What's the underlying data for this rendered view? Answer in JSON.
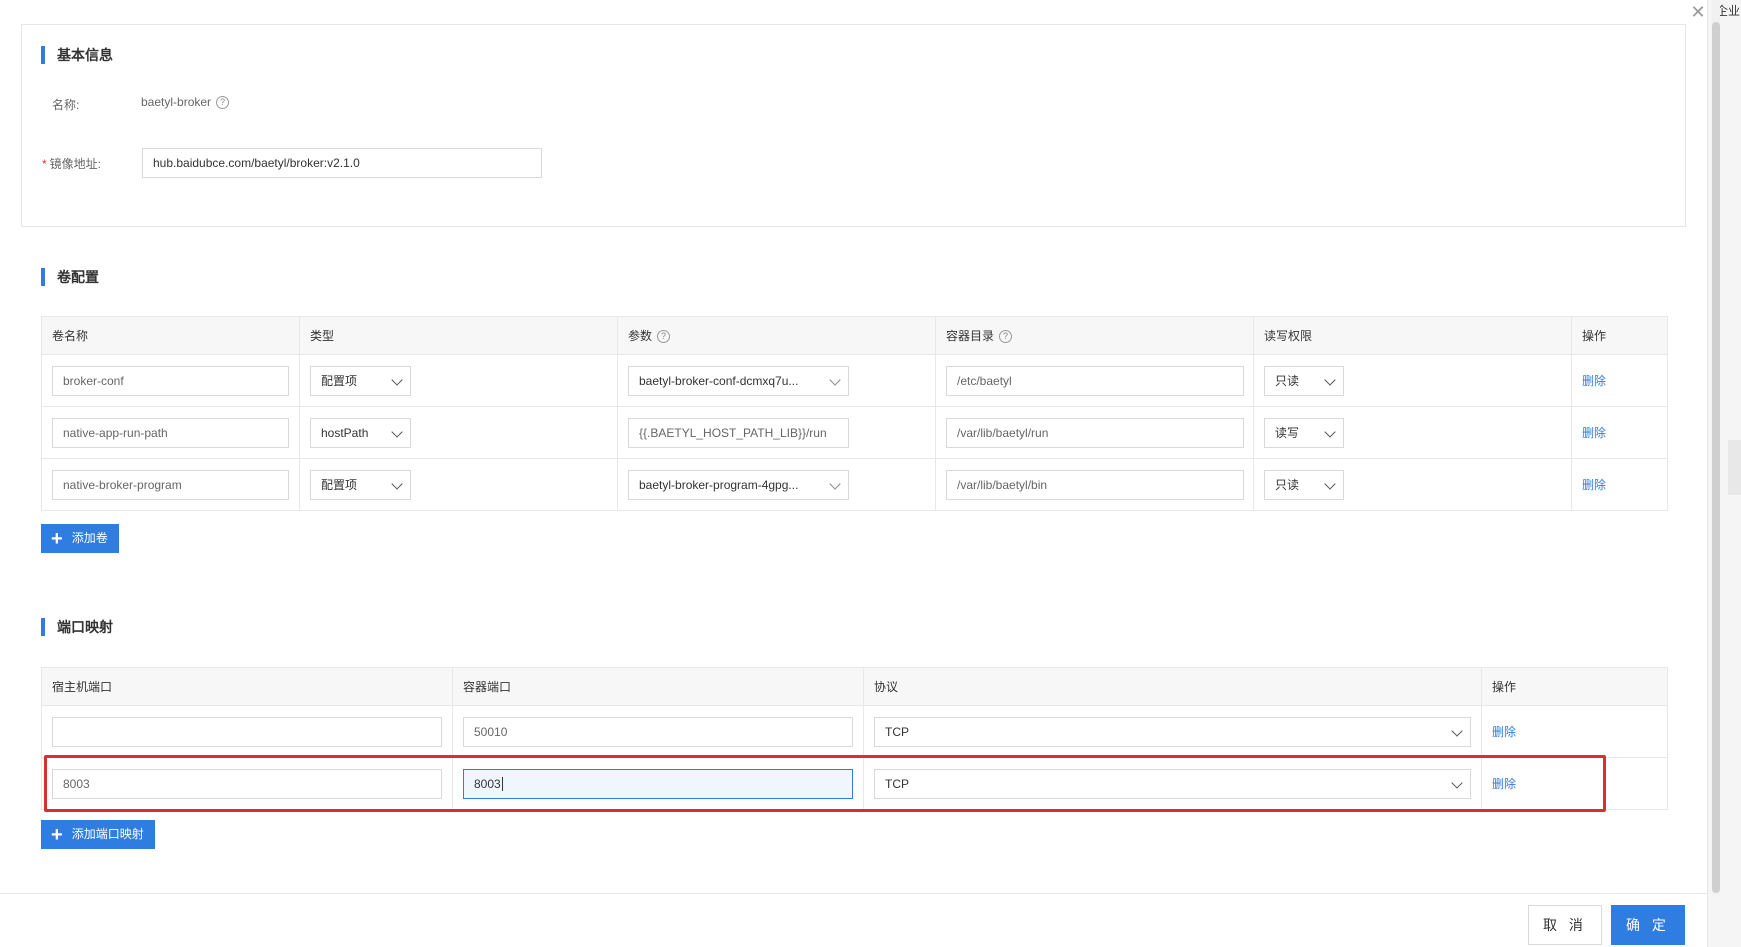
{
  "basic_info": {
    "title": "基本信息",
    "name_label": "名称:",
    "name_value": "baetyl-broker",
    "image_label": "镜像地址:",
    "image_value": "hub.baidubce.com/baetyl/broker:v2.1.0"
  },
  "volumes": {
    "title": "卷配置",
    "columns": [
      "卷名称",
      "类型",
      "参数",
      "容器目录",
      "读写权限",
      "操作"
    ],
    "rows": [
      {
        "name": "broker-conf",
        "type": "配置项",
        "param": "baetyl-broker-conf-dcmxq7u...",
        "dir": "/etc/baetyl",
        "perm": "只读",
        "action": "删除"
      },
      {
        "name": "native-app-run-path",
        "type": "hostPath",
        "param": "{{.BAETYL_HOST_PATH_LIB}}/run",
        "dir": "/var/lib/baetyl/run",
        "perm": "读写",
        "action": "删除"
      },
      {
        "name": "native-broker-program",
        "type": "配置项",
        "param": "baetyl-broker-program-4gpg...",
        "dir": "/var/lib/baetyl/bin",
        "perm": "只读",
        "action": "删除"
      }
    ],
    "add_label": "添加卷"
  },
  "ports": {
    "title": "端口映射",
    "columns": [
      "宿主机端口",
      "容器端口",
      "协议",
      "操作"
    ],
    "rows": [
      {
        "host": "",
        "container": "50010",
        "protocol": "TCP",
        "action": "删除"
      },
      {
        "host": "8003",
        "container": "8003",
        "protocol": "TCP",
        "action": "删除"
      }
    ],
    "add_label": "添加端口映射"
  },
  "footer": {
    "cancel_label": "取 消",
    "ok_label": "确 定"
  },
  "background_panel_text": "企业",
  "colors": {
    "accent": "#2f7de1",
    "highlight": "#d63031",
    "danger": "#ea2e2e"
  }
}
